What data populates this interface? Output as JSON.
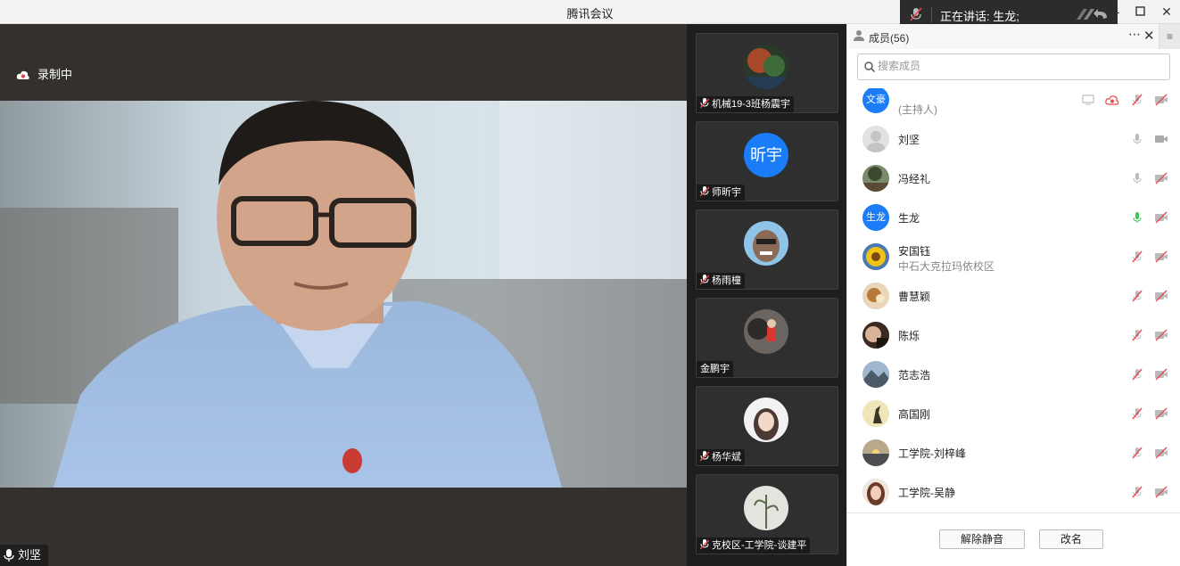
{
  "window": {
    "title": "腾讯会议"
  },
  "speaking": {
    "text": "正在讲话: 生龙;"
  },
  "recording": {
    "label": "录制中"
  },
  "main_video": {
    "name": "刘坚"
  },
  "thumbnails": [
    {
      "name": "机械19-3班杨震宇",
      "avatar_text": ""
    },
    {
      "name": "师昕宇",
      "avatar_text": "昕宇"
    },
    {
      "name": "杨雨橦",
      "avatar_text": ""
    },
    {
      "name": "金鹏宇",
      "avatar_text": ""
    },
    {
      "name": "杨华斌",
      "avatar_text": ""
    },
    {
      "name": "克校区-工学院-谈建平",
      "avatar_text": ""
    }
  ],
  "panel": {
    "title": "成员(56)",
    "search_placeholder": "搜索成员",
    "members": [
      {
        "name": "",
        "sub": "(主持人)",
        "avatar_text": "文豪"
      },
      {
        "name": "刘坚",
        "sub": "",
        "avatar_text": ""
      },
      {
        "name": "冯经礼",
        "sub": "",
        "avatar_text": ""
      },
      {
        "name": "生龙",
        "sub": "",
        "avatar_text": "生龙"
      },
      {
        "name": "安国钰",
        "sub": "中石大克拉玛依校区",
        "avatar_text": ""
      },
      {
        "name": "曹慧颖",
        "sub": "",
        "avatar_text": ""
      },
      {
        "name": "陈烁",
        "sub": "",
        "avatar_text": ""
      },
      {
        "name": "范志浩",
        "sub": "",
        "avatar_text": ""
      },
      {
        "name": "高国刚",
        "sub": "",
        "avatar_text": ""
      },
      {
        "name": "工学院-刘梓峰",
        "sub": "",
        "avatar_text": ""
      },
      {
        "name": "工学院-吴静",
        "sub": "",
        "avatar_text": ""
      }
    ],
    "unmute_all_label": "解除静音",
    "rename_label": "改名"
  }
}
